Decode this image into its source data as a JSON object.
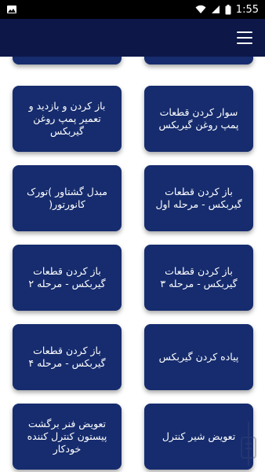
{
  "status_bar": {
    "time": "1:55",
    "icons": [
      "image-icon",
      "wifi-icon",
      "signal-icon",
      "battery-icon"
    ]
  },
  "app_bar": {
    "menu_icon": "hamburger-menu-icon",
    "color": "#0d1748"
  },
  "cards": [
    {
      "id": "partial-left",
      "label": ""
    },
    {
      "id": "partial-right",
      "label": ""
    },
    {
      "id": "c1",
      "label": "سوار کردن قطعات پمپ روغن گیربکس"
    },
    {
      "id": "c2",
      "label": "باز کردن و بازدید و تعمیر پمپ روغن گیربکس"
    },
    {
      "id": "c3",
      "label": "باز کردن قطعات گیربکس - مرحله اول"
    },
    {
      "id": "c4",
      "label": "مبدل گشتاور )تورک کانورتور("
    },
    {
      "id": "c5",
      "label": "باز کردن قطعات گیربکس - مرحله ۳"
    },
    {
      "id": "c6",
      "label": "باز کردن قطعات گیربکس - مرحله ۲"
    },
    {
      "id": "c7",
      "label": "پیاده کردن گیربکس"
    },
    {
      "id": "c8",
      "label": "باز کردن قطعات گیربکس - مرحله ۴"
    },
    {
      "id": "c9",
      "label": "تعویض شیر کنترل"
    },
    {
      "id": "c10",
      "label": "تعویض فنر برگشت پیستون کنترل کننده خودکار"
    }
  ],
  "colors": {
    "card": "#162c6e",
    "app_bar": "#0d1748",
    "background": "#ffffff"
  }
}
